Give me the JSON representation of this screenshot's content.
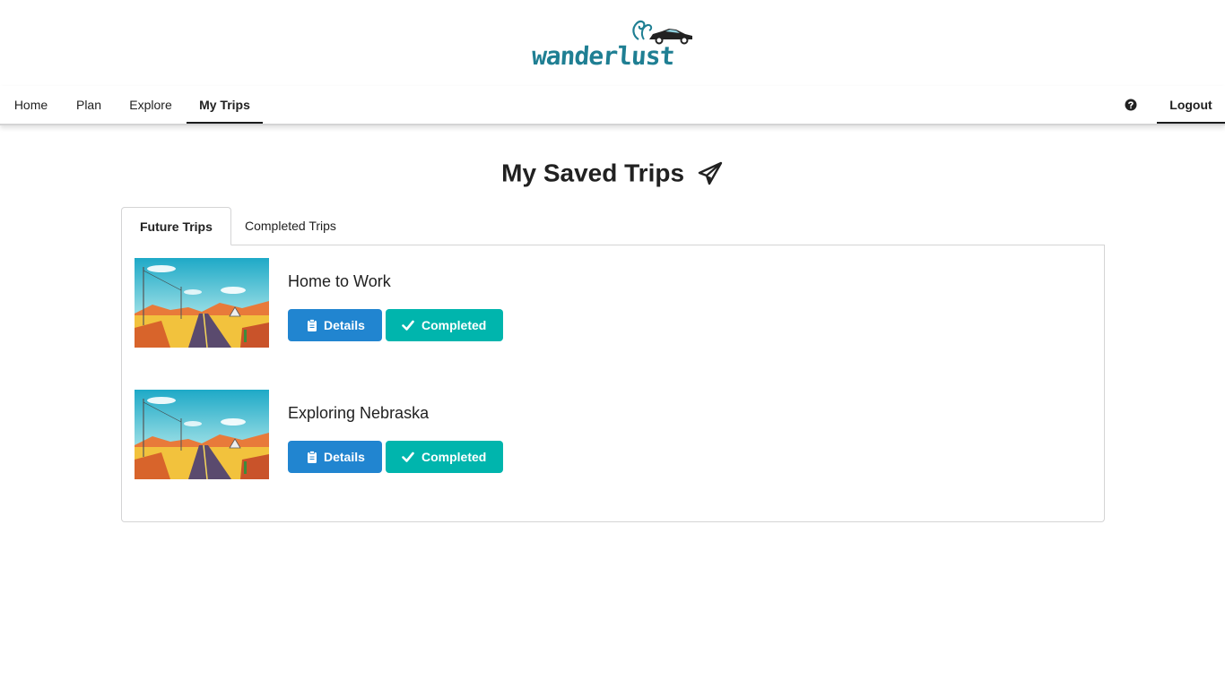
{
  "app": {
    "logo_text": "wanderlust"
  },
  "nav": {
    "items": [
      {
        "label": "Home"
      },
      {
        "label": "Plan"
      },
      {
        "label": "Explore"
      },
      {
        "label": "My Trips",
        "active": true
      }
    ],
    "help_icon": "question-circle-icon",
    "logout_label": "Logout"
  },
  "page": {
    "title": "My Saved Trips",
    "title_icon": "paper-plane-icon"
  },
  "tabs": [
    {
      "label": "Future Trips",
      "active": true
    },
    {
      "label": "Completed Trips",
      "active": false
    }
  ],
  "trips": [
    {
      "name": "Home to Work",
      "details_label": "Details",
      "completed_label": "Completed"
    },
    {
      "name": "Exploring Nebraska",
      "details_label": "Details",
      "completed_label": "Completed"
    }
  ],
  "colors": {
    "primary": "#2185d0",
    "teal": "#00b5ad",
    "logo": "#1f7f93"
  }
}
